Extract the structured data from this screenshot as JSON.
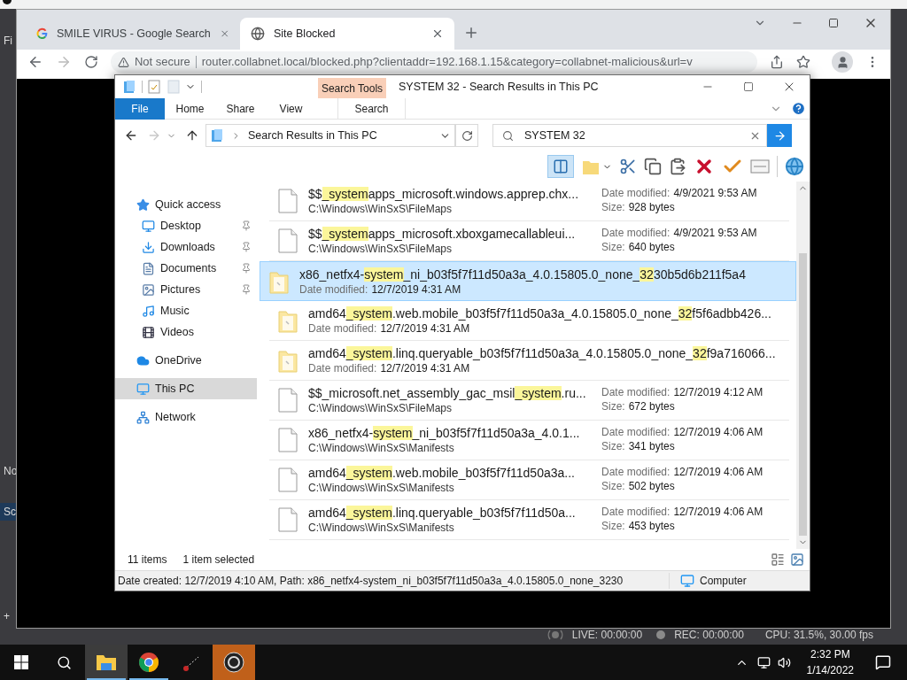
{
  "obs": {
    "side_fragments": [
      {
        "text": "Fi",
        "selected": false
      },
      {
        "text": "No",
        "selected": false
      },
      {
        "text": "Sc",
        "selected": true
      },
      {
        "text": "+",
        "selected": false
      }
    ],
    "status": {
      "live": "LIVE: 00:00:00",
      "rec": "REC: 00:00:00",
      "cpu": "CPU: 31.5%, 30.00 fps"
    }
  },
  "browser": {
    "tabs": [
      {
        "title": "SMILE VIRUS - Google Search",
        "kind": "google",
        "selected": false
      },
      {
        "title": "Site Blocked",
        "kind": "globe",
        "selected": true
      }
    ],
    "address": {
      "security": "Not secure",
      "url": "router.collabnet.local/blocked.php?clientaddr=192.168.1.15&category=collabnet-malicious&url=v"
    }
  },
  "explorer": {
    "title": "SYSTEM 32 - Search Results in This PC",
    "context_tab": "Search Tools",
    "ribbon_tabs": [
      {
        "label": "File",
        "kind": "file"
      },
      {
        "label": "Home",
        "kind": "plain"
      },
      {
        "label": "Share",
        "kind": "plain"
      },
      {
        "label": "View",
        "kind": "plain"
      },
      {
        "label": "Search",
        "kind": "context"
      }
    ],
    "address": "Search Results in This PC",
    "search": "SYSTEM 32",
    "nav": [
      {
        "label": "Quick access",
        "selected": false,
        "children": [
          {
            "label": "Desktop",
            "pinned": true,
            "selected": false
          },
          {
            "label": "Downloads",
            "pinned": true,
            "selected": false
          },
          {
            "label": "Documents",
            "pinned": true,
            "selected": false
          },
          {
            "label": "Pictures",
            "pinned": true,
            "selected": false
          },
          {
            "label": "Music",
            "pinned": false,
            "selected": false
          },
          {
            "label": "Videos",
            "pinned": false,
            "selected": false
          }
        ]
      },
      {
        "label": "OneDrive",
        "selected": false
      },
      {
        "label": "This PC",
        "selected": true
      },
      {
        "label": "Network",
        "selected": false
      }
    ],
    "files": [
      {
        "kind": "file",
        "selected": false,
        "name": [
          {
            "text": "$$",
            "highlighted": false
          },
          {
            "text": "_system",
            "highlighted": true
          },
          {
            "text": "apps_microsoft.windows.apprep.chx...",
            "highlighted": false
          }
        ],
        "location": "C:\\Windows\\WinSxS\\FileMaps",
        "date_label": "Date modified:",
        "date": "4/9/2021 9:53 AM",
        "size_label": "Size:",
        "size": "928 bytes"
      },
      {
        "kind": "file",
        "selected": false,
        "name": [
          {
            "text": "$$",
            "highlighted": false
          },
          {
            "text": "_system",
            "highlighted": true
          },
          {
            "text": "apps_microsoft.xboxgamecallableui...",
            "highlighted": false
          }
        ],
        "location": "C:\\Windows\\WinSxS\\FileMaps",
        "date_label": "Date modified:",
        "date": "4/9/2021 9:53 AM",
        "size_label": "Size:",
        "size": "640 bytes"
      },
      {
        "kind": "folder",
        "selected": true,
        "name": [
          {
            "text": "x86_netfx4-",
            "highlighted": false
          },
          {
            "text": "system",
            "highlighted": true
          },
          {
            "text": "_ni_b03f5f7f11d50a3a_4.0.15805.0_none_",
            "highlighted": false
          },
          {
            "text": "32",
            "highlighted": true
          },
          {
            "text": "30b5d6b211f5a4",
            "highlighted": false
          }
        ],
        "date_label": "Date modified:",
        "date": "12/7/2019 4:31 AM"
      },
      {
        "kind": "folder",
        "selected": false,
        "name": [
          {
            "text": "amd64",
            "highlighted": false
          },
          {
            "text": "_system",
            "highlighted": true
          },
          {
            "text": ".web.mobile_b03f5f7f11d50a3a_4.0.15805.0_none_",
            "highlighted": false
          },
          {
            "text": "32",
            "highlighted": true
          },
          {
            "text": "f5f6adbb426...",
            "highlighted": false
          }
        ],
        "date_label": "Date modified:",
        "date": "12/7/2019 4:31 AM"
      },
      {
        "kind": "folder",
        "selected": false,
        "name": [
          {
            "text": "amd64",
            "highlighted": false
          },
          {
            "text": "_system",
            "highlighted": true
          },
          {
            "text": ".linq.queryable_b03f5f7f11d50a3a_4.0.15805.0_none_",
            "highlighted": false
          },
          {
            "text": "32",
            "highlighted": true
          },
          {
            "text": "f9a716066...",
            "highlighted": false
          }
        ],
        "date_label": "Date modified:",
        "date": "12/7/2019 4:31 AM"
      },
      {
        "kind": "file",
        "selected": false,
        "name": [
          {
            "text": "$$_microsoft.net_assembly_gac_msil",
            "highlighted": false
          },
          {
            "text": "_system",
            "highlighted": true
          },
          {
            "text": ".ru...",
            "highlighted": false
          }
        ],
        "location": "C:\\Windows\\WinSxS\\FileMaps",
        "date_label": "Date modified:",
        "date": "12/7/2019 4:12 AM",
        "size_label": "Size:",
        "size": "672 bytes"
      },
      {
        "kind": "file",
        "selected": false,
        "name": [
          {
            "text": "x86_netfx4-",
            "highlighted": false
          },
          {
            "text": "system",
            "highlighted": true
          },
          {
            "text": "_ni_b03f5f7f11d50a3a_4.0.1...",
            "highlighted": false
          }
        ],
        "location": "C:\\Windows\\WinSxS\\Manifests",
        "date_label": "Date modified:",
        "date": "12/7/2019 4:06 AM",
        "size_label": "Size:",
        "size": "341 bytes"
      },
      {
        "kind": "file",
        "selected": false,
        "name": [
          {
            "text": "amd64",
            "highlighted": false
          },
          {
            "text": "_system",
            "highlighted": true
          },
          {
            "text": ".web.mobile_b03f5f7f11d50a3a...",
            "highlighted": false
          }
        ],
        "location": "C:\\Windows\\WinSxS\\Manifests",
        "date_label": "Date modified:",
        "date": "12/7/2019 4:06 AM",
        "size_label": "Size:",
        "size": "502 bytes"
      },
      {
        "kind": "file",
        "selected": false,
        "name": [
          {
            "text": "amd64",
            "highlighted": false
          },
          {
            "text": "_system",
            "highlighted": true
          },
          {
            "text": ".linq.queryable_b03f5f7f11d50a...",
            "highlighted": false
          }
        ],
        "location": "C:\\Windows\\WinSxS\\Manifests",
        "date_label": "Date modified:",
        "date": "12/7/2019 4:06 AM",
        "size_label": "Size:",
        "size": "453 bytes"
      }
    ],
    "status": {
      "count": "11 items",
      "selection": "1 item selected"
    },
    "details": {
      "text": "Date created: 12/7/2019 4:10 AM, Path: x86_netfx4-system_ni_b03f5f7f11d50a3a_4.0.15805.0_none_3230",
      "location": "Computer"
    }
  },
  "taskbar": {
    "apps": [
      {
        "kind": "explorer",
        "active": true,
        "running": true,
        "attention": false
      },
      {
        "kind": "chrome",
        "active": false,
        "running": true,
        "attention": false
      },
      {
        "kind": "app",
        "active": false,
        "running": false,
        "attention": false
      },
      {
        "kind": "obs",
        "active": false,
        "running": false,
        "attention": true
      }
    ],
    "time": "2:32 PM",
    "date": "1/14/2022"
  }
}
